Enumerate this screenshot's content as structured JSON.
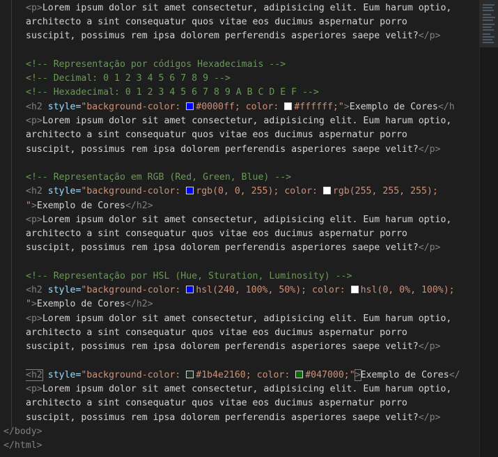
{
  "editor": {
    "para_open": "<p>",
    "para_close": "</p>",
    "para_line1": "Lorem ipsum dolor sit amet consectetur, adipisicing elit. Eum harum optio,",
    "para_line2": "architecto a sint consequatur quos vitae eos ducimus aspernatur porro",
    "para_line3": "suscipit, possimus rem ipsa dolorem perferendis asperiores saepe velit?",
    "comment_hex": "<!-- Representação por códigos Hexadecimais -->",
    "comment_decimal": "<!-- Decimal: 0 1 2 3 4 5 6 7 8 9 -->",
    "comment_hexadecimal": "<!-- Hexadecimal: 0 1 2 3 4 5 6 7 8 9 A B C D E F -->",
    "comment_rgb": "<!-- Representação em RGB (Red, Green, Blue) -->",
    "comment_hsl": "<!-- Representação por HSL (Hue, Sturation, Luminosity) -->",
    "h2_open": "<h2",
    "h2_close": "</h2>",
    "h2_close_cut": "</h",
    "h2_close_cut2": "</",
    "attr_style": " style=",
    "quote": "\"",
    "quote_close_gt": "\">",
    "bg_prop": "background-color: ",
    "color_prop": "; color: ",
    "end_semicolon": ";",
    "heading_text": "Exemplo de Cores",
    "hex_bg": "#0000ff",
    "hex_fg": "#ffffff",
    "rgb_bg": "rgb(0, 0, 255)",
    "rgb_fg": "rgb(255, 255, 255);",
    "hsl_bg": "hsl(240, 100%, 50%)",
    "hsl_fg": "hsl(0, 0%, 100%);",
    "custom_bg": "#1b4e2160",
    "custom_fg": "#047000",
    "body_close": "</body>",
    "html_close": "</html>"
  },
  "swatches": {
    "blue": "#0000ff",
    "white": "#ffffff",
    "custom_bg": "#1b4e2160",
    "custom_fg": "#047000"
  }
}
